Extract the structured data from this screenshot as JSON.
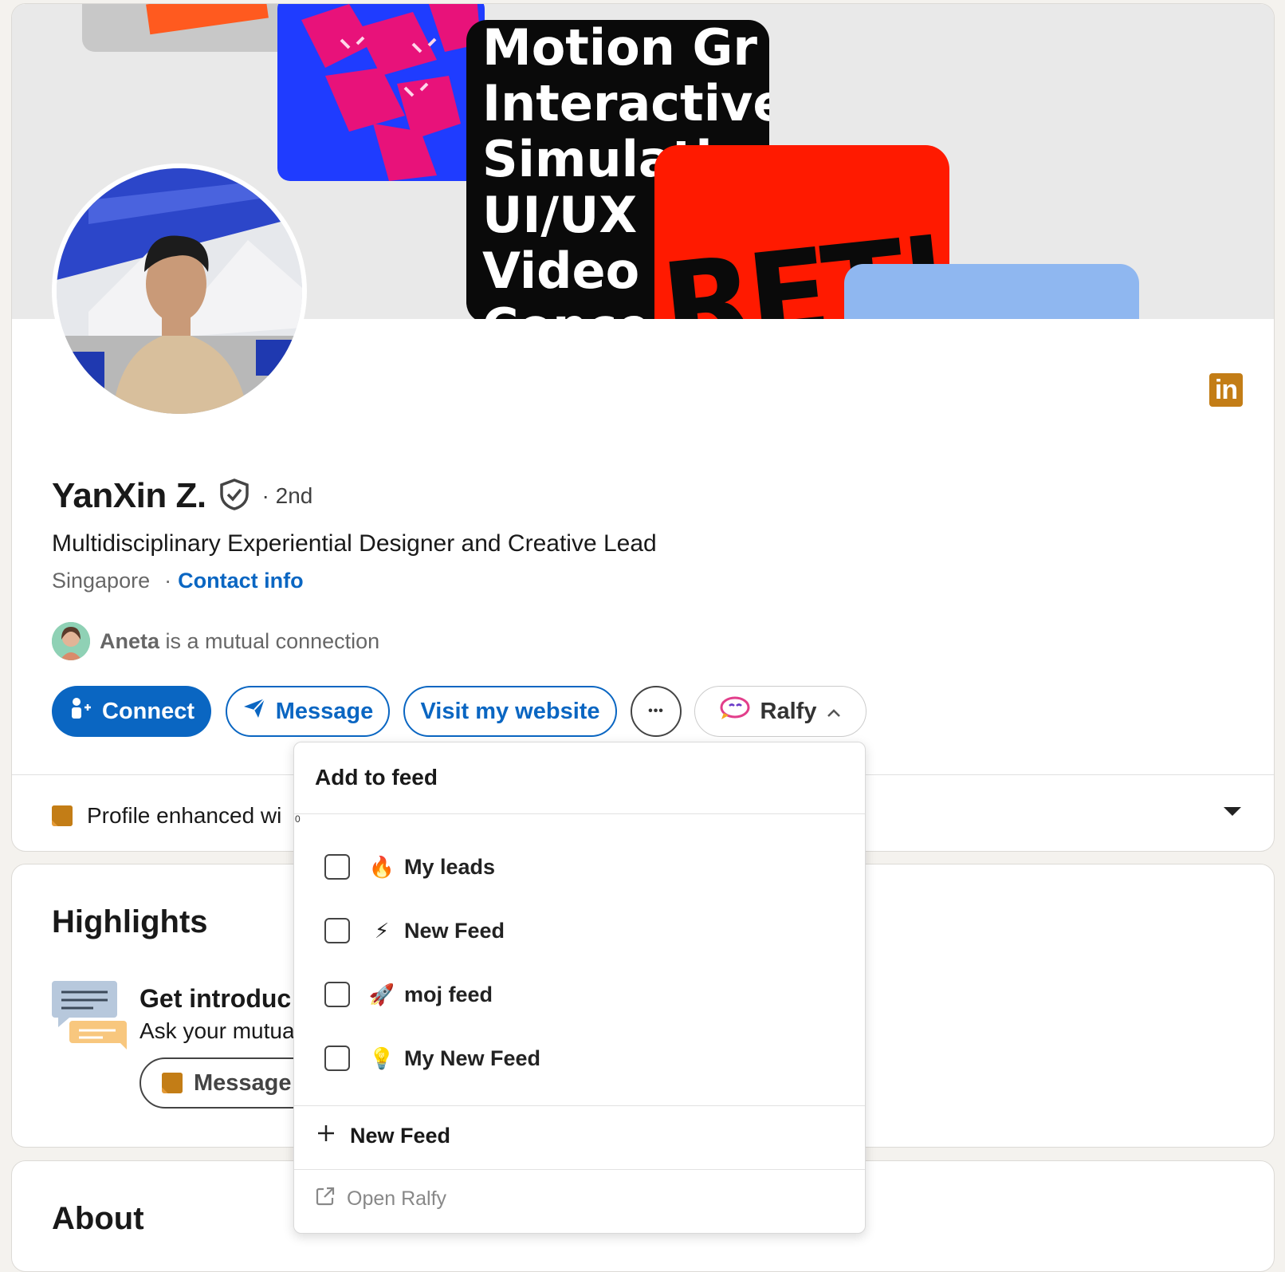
{
  "banner": {
    "lines": [
      "Motion Gr",
      "Interactive",
      "Simulation",
      "UI/UX",
      "Video",
      "Conce"
    ],
    "red_text": "RET!"
  },
  "profile": {
    "name": "YanXin Z.",
    "degree": "· 2nd",
    "headline": "Multidisciplinary Experiential Designer and Creative Lead",
    "location": "Singapore",
    "location_sep": "·",
    "contact_info": "Contact info",
    "mutual_name": "Aneta",
    "mutual_text": "is a mutual connection",
    "linkedin_icon_text": "in"
  },
  "actions": {
    "connect": "Connect",
    "message": "Message",
    "website": "Visit my website",
    "more": "•••",
    "ralfy": "Ralfy"
  },
  "enhanced": {
    "label": "Profile enhanced wi",
    "tiny": "0"
  },
  "highlights": {
    "title": "Highlights",
    "intro_title": "Get introduc",
    "intro_sub": "Ask your mutua",
    "message_btn": "Message"
  },
  "about": {
    "title": "About"
  },
  "dropdown": {
    "header": "Add to feed",
    "feeds": [
      {
        "emoji": "🔥",
        "label": "My leads"
      },
      {
        "emoji": "⚡",
        "label": "New Feed"
      },
      {
        "emoji": "🚀",
        "label": "moj feed"
      },
      {
        "emoji": "💡",
        "label": "My New Feed"
      }
    ],
    "new_feed": "New Feed",
    "open_ralfy": "Open Ralfy"
  },
  "colors": {
    "accent": "#0a66c2",
    "brand_icon": "#c37d16"
  }
}
